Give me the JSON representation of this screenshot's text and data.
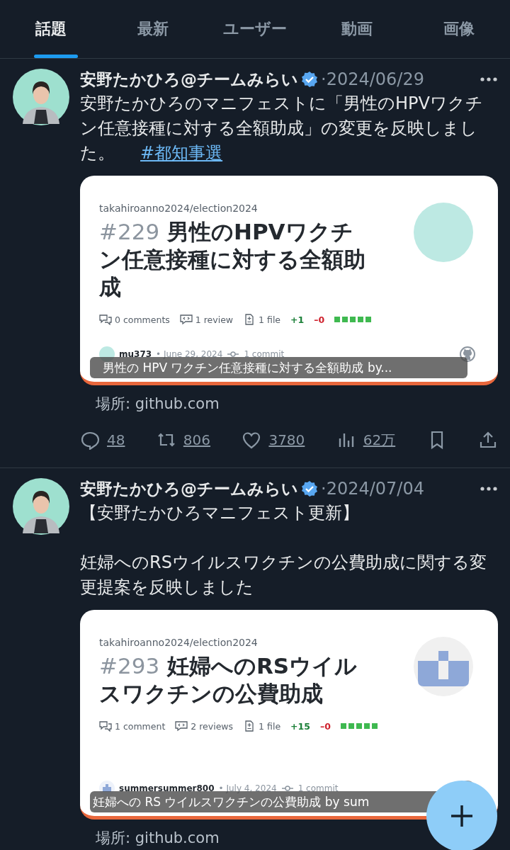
{
  "tabs": [
    {
      "label": "話題",
      "selected": true
    },
    {
      "label": "最新",
      "selected": false
    },
    {
      "label": "ユーザー",
      "selected": false
    },
    {
      "label": "動画",
      "selected": false
    },
    {
      "label": "画像",
      "selected": false
    }
  ],
  "posts": [
    {
      "author": "安野たかひろ@チームみらい",
      "verified": true,
      "date": "·2024/06/29",
      "paragraphs": [
        "安野たかひろのマニフェストに「男性のHPVワクチン任意接種に対する全額助成」の変更を反映しました。"
      ],
      "hashtag": "#都知事選",
      "card": {
        "repo": "takahiroanno2024/election2024",
        "number": "#229",
        "title": "男性のHPVワクチン任意接種に対する全額助成",
        "comments": "0 comments",
        "reviews": "1 review",
        "files": "1 file",
        "additions": "+1",
        "deletions": "–0",
        "thumb": {
          "kind": "circle"
        },
        "user": "mu373",
        "user_date": "• June 29, 2024",
        "commits": "1 commit",
        "caption": "男性の HPV ワクチン任意接種に対する全額助成 by..."
      },
      "location": "場所: github.com",
      "actions": [
        {
          "kind": "reply",
          "count": "48"
        },
        {
          "kind": "repost",
          "count": "806"
        },
        {
          "kind": "like",
          "count": "3780"
        },
        {
          "kind": "views",
          "count": "62万"
        },
        {
          "kind": "bookmark"
        },
        {
          "kind": "share"
        }
      ]
    },
    {
      "author": "安野たかひろ@チームみらい",
      "verified": true,
      "date": "·2024/07/04",
      "paragraphs": [
        "【安野たかひろマニフェスト更新】",
        "妊婦へのRSウイルスワクチンの公費助成に関する変更提案を反映しました"
      ],
      "card": {
        "repo": "takahiroanno2024/election2024",
        "number": "#293",
        "title": "妊婦へのRSウイルスワクチンの公費助成",
        "comments": "1 comment",
        "reviews": "2 reviews",
        "files": "1 file",
        "additions": "+15",
        "deletions": "–0",
        "thumb": {
          "kind": "identicon"
        },
        "user": "summersummer800",
        "user_date": "• July 4, 2024",
        "commits": "1 commit",
        "caption": "妊婦への RS ウイルスワクチンの公費助成 by sum"
      },
      "location": "場所: github.com"
    }
  ]
}
